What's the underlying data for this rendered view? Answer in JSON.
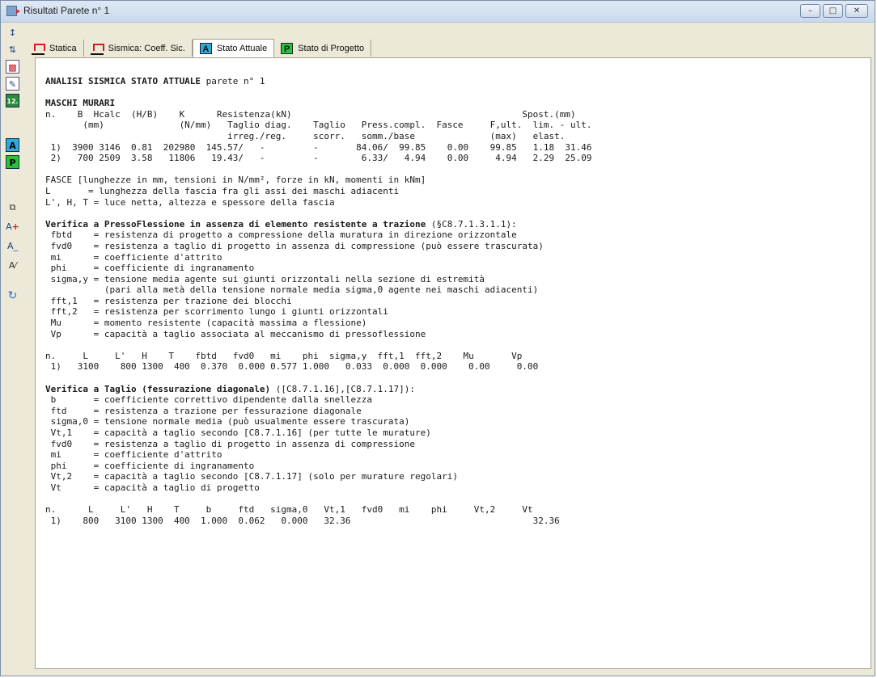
{
  "window": {
    "title": "Risultati Parete n° 1",
    "buttons": [
      "minimize",
      "maximize",
      "close"
    ]
  },
  "left_toolbar": {
    "icons": [
      "move-icon",
      "multi-move-icon",
      "chart-icon",
      "edit-icon",
      "number-12-icon",
      "stato-attuale-icon",
      "stato-progetto-icon",
      "copy-icon",
      "font-increase-icon",
      "font-decrease-icon",
      "font-style-icon",
      "refresh-icon"
    ],
    "labels": {
      "num": "12.",
      "a": "A",
      "p": "P",
      "font_inc": "A",
      "font_dec": "A",
      "font_style": "A"
    }
  },
  "tabs": [
    {
      "label": "Statica",
      "icon": "structure-icon"
    },
    {
      "label": "Sismica: Coeff. Sic.",
      "icon": "structure-red-icon"
    },
    {
      "label": "Stato Attuale",
      "letter": "A",
      "active": true
    },
    {
      "label": "Stato di Progetto",
      "letter": "P"
    }
  ],
  "report": {
    "title_bold": "ANALISI SISMICA STATO ATTUALE",
    "title_rest": " parete n° 1",
    "maschi_title": "MASCHI MURARI",
    "maschi_header": [
      "n.    B  Hcalc  (H/B)    K      Resistenza(kN)                                           Spost.(mm)",
      "       (mm)              (N/mm)   Taglio diag.    Taglio   Press.compl.  Fasce     F,ult.  lim. - ult.",
      "                                  irreg./reg.     scorr.   somm./base              (max)   elast."
    ],
    "maschi_rows": [
      " 1)  3900 3146  0.81  202980  145.57/   -         -       84.06/  99.85    0.00    99.85   1.18  31.46",
      " 2)   700 2509  3.58   11806   19.43/   -         -        6.33/   4.94    0.00     4.94   2.29  25.09"
    ],
    "fasce_lines": [
      "FASCE [lunghezze in mm, tensioni in N/mm², forze in kN, momenti in kNm]",
      "L       = lunghezza della fascia fra gli assi dei maschi adiacenti",
      "L', H, T = luce netta, altezza e spessore della fascia"
    ],
    "pf_title_bold": "Verifica a PressoFlessione in assenza di elemento resistente a trazione",
    "pf_title_rest": " (§C8.7.1.3.1.1):",
    "pf_legend": [
      " fbtd    = resistenza di progetto a compressione della muratura in direzione orizzontale",
      " fvd0    = resistenza a taglio di progetto in assenza di compressione (può essere trascurata)",
      " mi      = coefficiente d'attrito",
      " phi     = coefficiente di ingranamento",
      " sigma,y = tensione media agente sui giunti orizzontali nella sezione di estremità",
      "           (pari alla metà della tensione normale media sigma,0 agente nei maschi adiacenti)",
      " fft,1   = resistenza per trazione dei blocchi",
      " fft,2   = resistenza per scorrimento lungo i giunti orizzontali",
      " Mu      = momento resistente (capacità massima a flessione)",
      " Vp      = capacità a taglio associata al meccanismo di pressoflessione"
    ],
    "pf_header": "n.     L     L'   H    T    fbtd   fvd0   mi    phi  sigma,y  fft,1  fft,2    Mu       Vp",
    "pf_row": " 1)   3100    800 1300  400  0.370  0.000 0.577 1.000   0.033  0.000  0.000    0.00     0.00",
    "t_title_bold": "Verifica a Taglio (fessurazione diagonale)",
    "t_title_rest": " ([C8.7.1.16],[C8.7.1.17]):",
    "t_legend": [
      " b       = coefficiente correttivo dipendente dalla snellezza",
      " ftd     = resistenza a trazione per fessurazione diagonale",
      " sigma,0 = tensione normale media (può usualmente essere trascurata)",
      " Vt,1    = capacità a taglio secondo [C8.7.1.16] (per tutte le murature)",
      " fvd0    = resistenza a taglio di progetto in assenza di compressione",
      " mi      = coefficiente d'attrito",
      " phi     = coefficiente di ingranamento",
      " Vt,2    = capacità a taglio secondo [C8.7.1.17] (solo per murature regolari)",
      " Vt      = capacità a taglio di progetto"
    ],
    "t_header": "n.      L     L'   H    T     b     ftd   sigma,0   Vt,1   fvd0   mi    phi     Vt,2     Vt",
    "t_row": " 1)    800   3100 1300  400  1.000  0.062   0.000   32.36                                  32.36"
  }
}
